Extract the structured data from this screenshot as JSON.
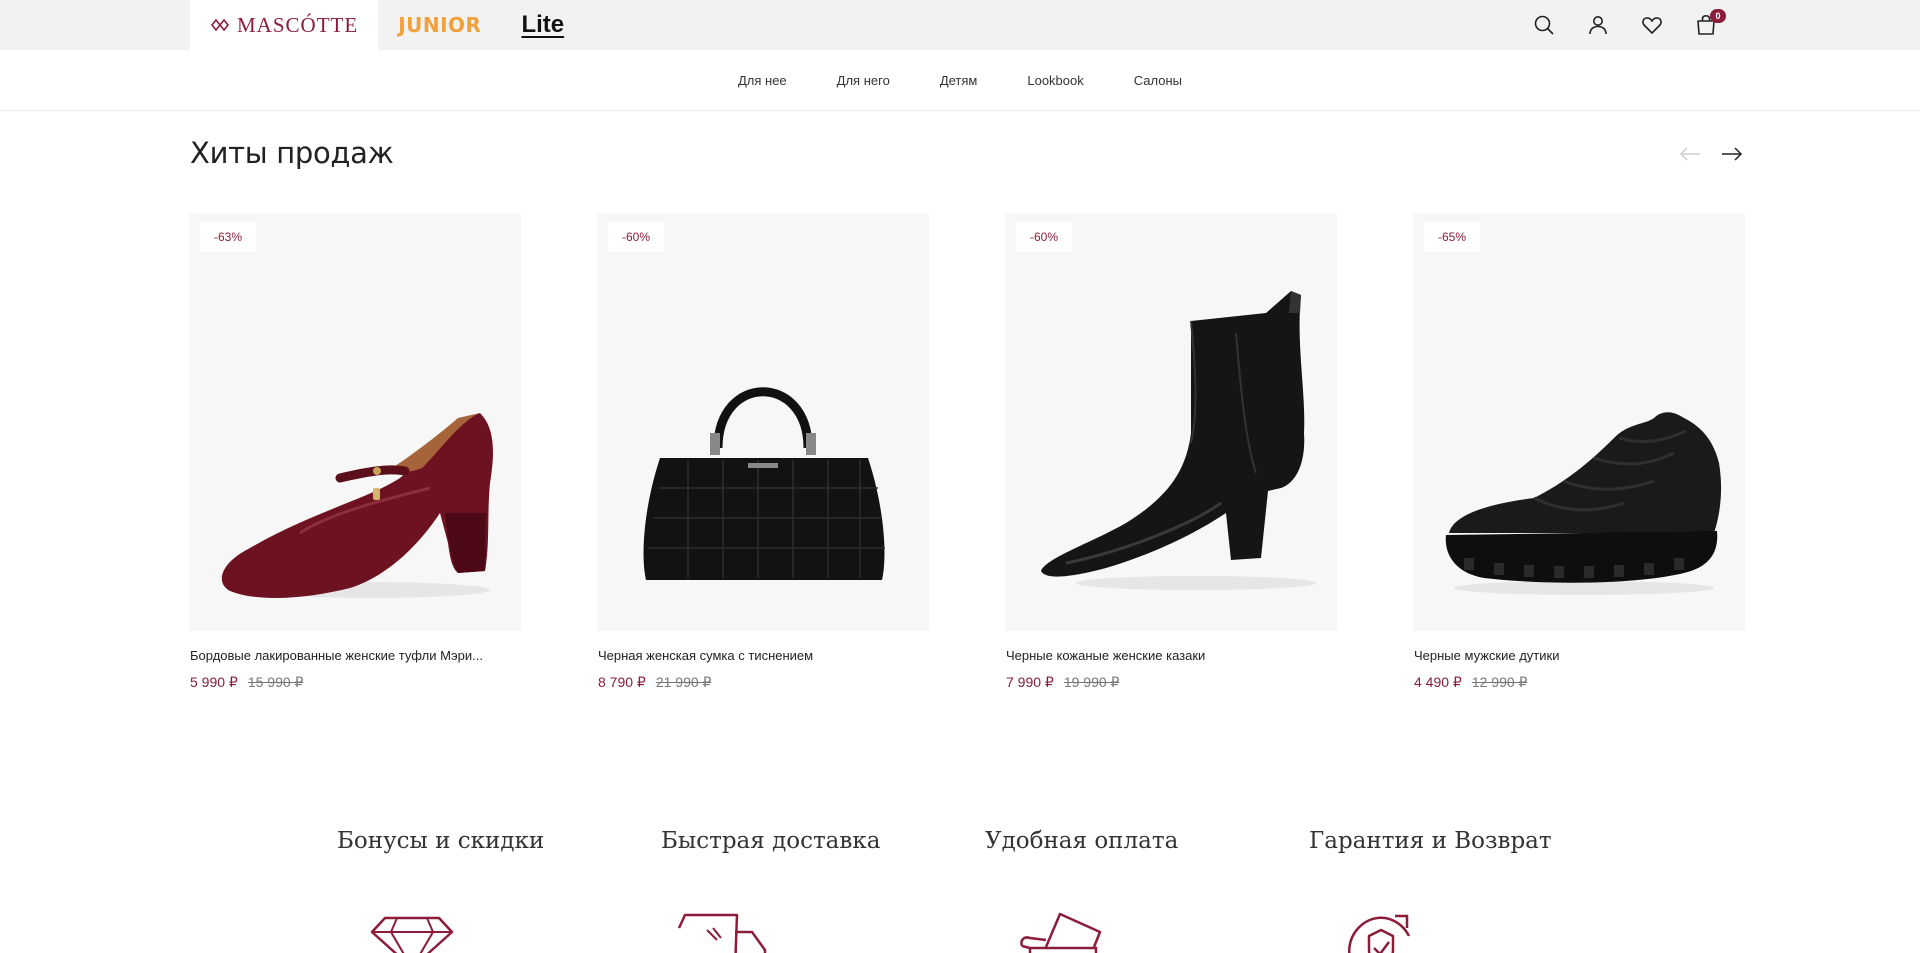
{
  "header": {
    "brands": [
      {
        "label": "MASCÓTTE",
        "active": true
      },
      {
        "label": "JUNIOR",
        "active": false
      },
      {
        "label": "Lite",
        "active": false
      }
    ],
    "icons": [
      "search-icon",
      "user-icon",
      "heart-icon",
      "cart-icon"
    ],
    "cart_count": "0"
  },
  "nav": {
    "items": [
      "Для нее",
      "Для него",
      "Детям",
      "Lookbook",
      "Салоны"
    ]
  },
  "section": {
    "title": "Хиты продаж"
  },
  "products": [
    {
      "badge": "-63%",
      "name": "Бордовые лакированные женские туфли Мэри...",
      "price": "5 990 ₽",
      "old_price": "15 990 ₽",
      "image": "burgundy-mary-jane-shoe"
    },
    {
      "badge": "-60%",
      "name": "Черная женская сумка с тиснением",
      "price": "8 790 ₽",
      "old_price": "21 990 ₽",
      "image": "black-croc-handbag"
    },
    {
      "badge": "-60%",
      "name": "Черные кожаные женские казаки",
      "price": "7 990 ₽",
      "old_price": "19 990 ₽",
      "image": "black-leather-ankle-boot"
    },
    {
      "badge": "-65%",
      "name": "Черные мужские дутики",
      "price": "4 490 ₽",
      "old_price": "12 990 ₽",
      "image": "black-padded-sneaker"
    }
  ],
  "benefits": [
    {
      "title": "Бонусы и скидки",
      "icon": "diamond-icon"
    },
    {
      "title": "Быстрая доставка",
      "icon": "truck-icon"
    },
    {
      "title": "Удобная оплата",
      "icon": "wallet-icon"
    },
    {
      "title": "Гарантия и Возврат",
      "icon": "shield-return-icon"
    }
  ],
  "colors": {
    "accent": "#8c1d3a",
    "junior": "#f2a03a",
    "topbar": "#f2f2f2",
    "card_bg": "#f7f7f7"
  }
}
